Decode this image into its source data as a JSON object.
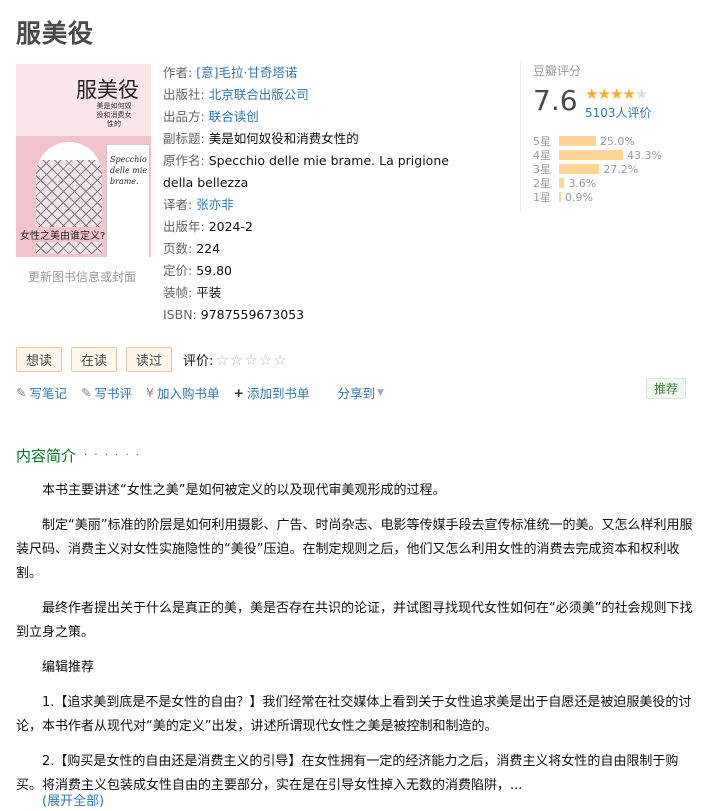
{
  "book": {
    "title": "服美役",
    "cover": {
      "title": "服美役",
      "subtitle": "美是如何奴役和消费女性的",
      "italic_title": "Specchio delle mie brame.",
      "question": "女性之美由谁定义?"
    },
    "cover_link": "更新图书信息或封面",
    "info": {
      "author_label": "作者:",
      "author": "[意]毛拉·甘奇塔诺",
      "publisher_label": "出版社:",
      "publisher": "北京联合出版公司",
      "producer_label": "出品方:",
      "producer": "联合读创",
      "subtitle_label": "副标题:",
      "subtitle": "美是如何奴役和消费女性的",
      "original_label": "原作名:",
      "original": "Specchio delle mie brame. La prigione della bellezza",
      "translator_label": "译者:",
      "translator": "张亦非",
      "year_label": "出版年:",
      "year": "2024-2",
      "pages_label": "页数:",
      "pages": "224",
      "price_label": "定价:",
      "price": "59.80",
      "binding_label": "装帧:",
      "binding": "平装",
      "isbn_label": "ISBN:",
      "isbn": "9787559673053"
    }
  },
  "rating": {
    "label": "豆瓣评分",
    "score": "7.6",
    "stars_filled": 4,
    "people": "5103人评价",
    "bars": [
      {
        "label": "5星",
        "value": 25.0,
        "text": "25.0%"
      },
      {
        "label": "4星",
        "value": 43.3,
        "text": "43.3%"
      },
      {
        "label": "3星",
        "value": 27.2,
        "text": "27.2%"
      },
      {
        "label": "2星",
        "value": 3.6,
        "text": "3.6%"
      },
      {
        "label": "1星",
        "value": 0.9,
        "text": "0.9%"
      }
    ]
  },
  "actions": {
    "want": "想读",
    "reading": "在读",
    "read": "读过",
    "rate_label": "评价:",
    "rate_stars": "☆☆☆☆☆"
  },
  "ops": {
    "note": "写笔记",
    "review": "写书评",
    "cart": "加入购书单",
    "booklist": "添加到书单",
    "share": "分享到",
    "recommend": "推荐"
  },
  "icons": {
    "note": "pencil-icon",
    "review": "pencil-icon",
    "cart": "yen-icon",
    "booklist": "plus-icon",
    "share": "chevron-down-icon"
  },
  "intro": {
    "title": "内容简介",
    "dots": "· · · · · ·",
    "p1": "本书主要讲述“女性之美”是如何被定义的以及现代审美观形成的过程。",
    "p2": "制定“美丽”标准的阶层是如何利用摄影、广告、时尚杂志、电影等传媒手段去宣传标准统一的美。又怎么样利用服装尺码、消费主义对女性实施隐性的“美役”压迫。在制定规则之后，他们又怎么利用女性的消费去完成资本和权利收割。",
    "p3": "最终作者提出关于什么是真正的美，美是否存在共识的论证，并试图寻找现代女性如何在“必须美”的社会规则下找到立身之策。",
    "p4": "编辑推荐",
    "p5": "1.【追求美到底是不是女性的自由？】我们经常在社交媒体上看到关于女性追求美是出于自愿还是被迫服美役的讨论，本书作者从现代对“美的定义”出发，讲述所谓现代女性之美是被控制和制造的。",
    "p6": "2.【购买是女性的自由还是消费主义的引导】在女性拥有一定的经济能力之后，消费主义将女性的自由限制于购买。将消费主义包装成女性自由的主要部分，实在是在引导女性掉入无数的消费陷阱，...",
    "more": "(展开全部)"
  }
}
